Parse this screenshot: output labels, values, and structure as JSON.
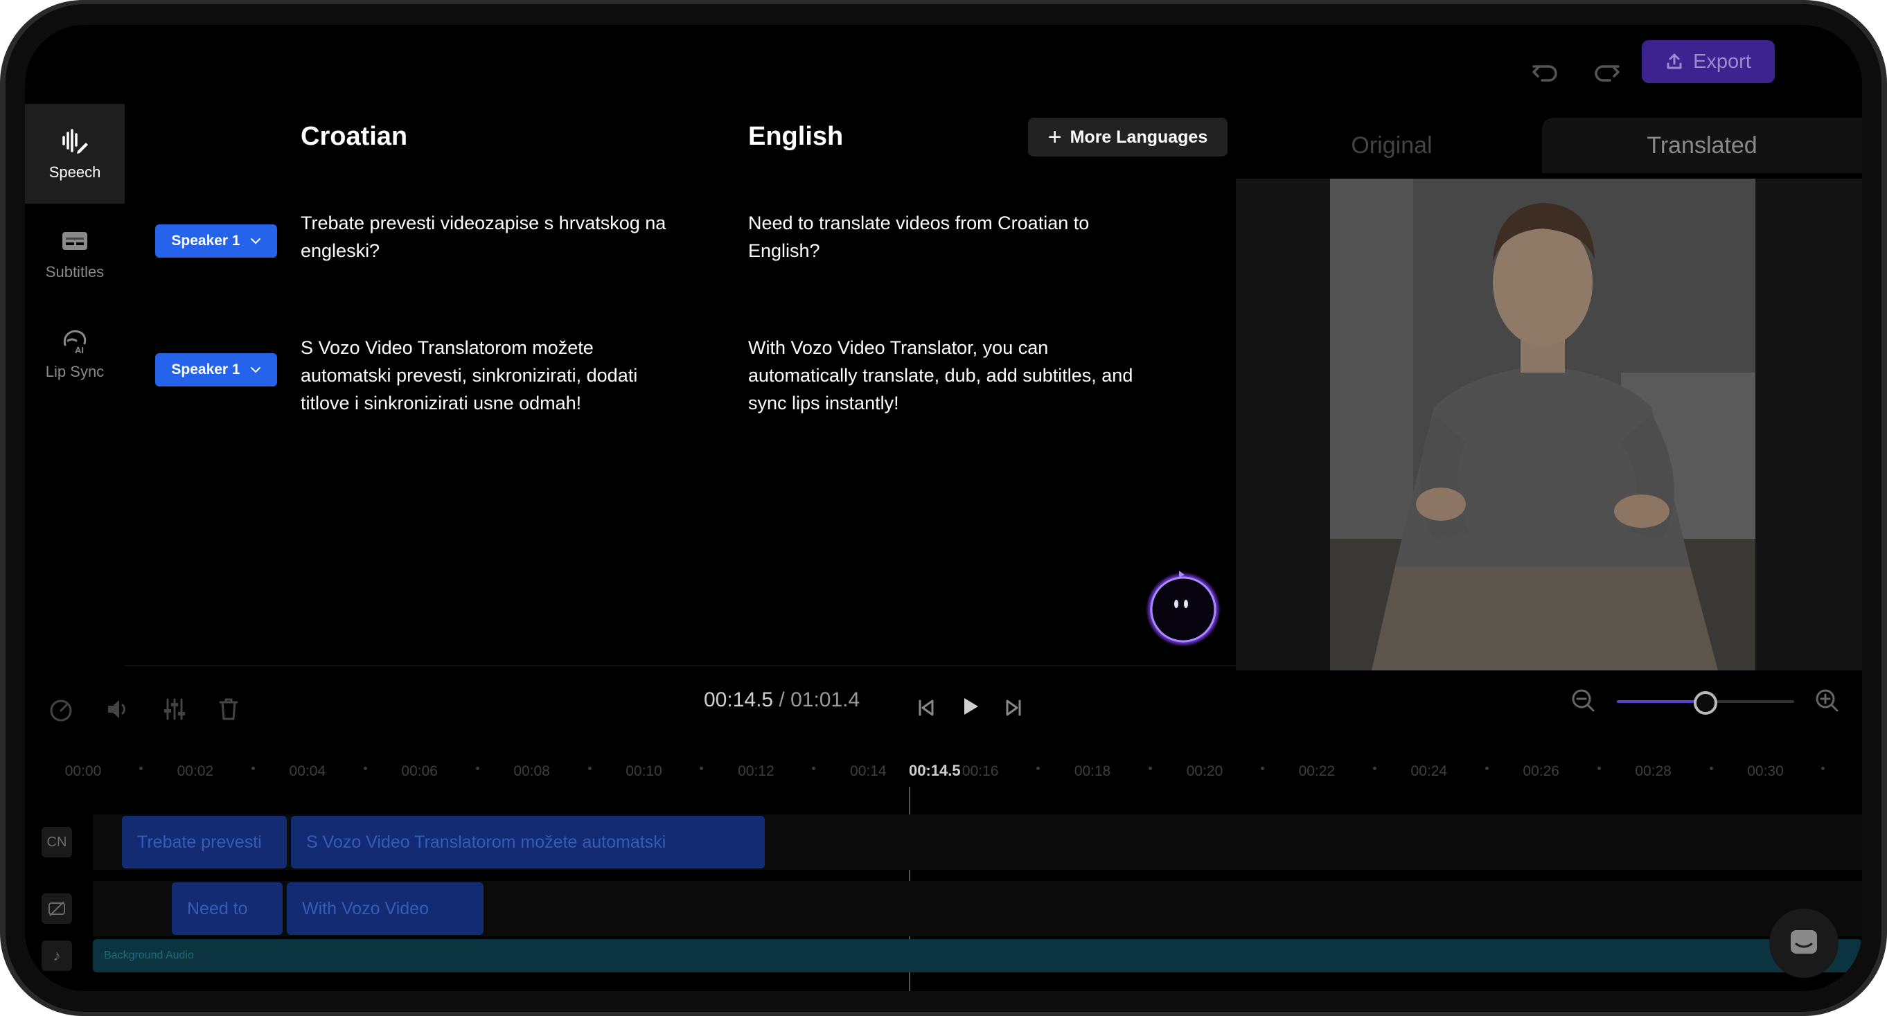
{
  "topbar": {
    "undo_icon": "undo-icon",
    "redo_icon": "redo-icon",
    "export_label": "Export"
  },
  "sidebar": {
    "items": [
      {
        "label": "Speech",
        "icon": "waveform-pen-icon"
      },
      {
        "label": "Subtitles",
        "icon": "subtitles-icon"
      },
      {
        "label": "Lip Sync",
        "icon": "ai-head-icon"
      }
    ]
  },
  "editor": {
    "source_language": "Croatian",
    "target_language": "English",
    "more_languages_label": "More Languages",
    "segments": [
      {
        "speaker": "Speaker 1",
        "source_text": "Trebate prevesti videozapise s hrvatskog na engleski?",
        "target_text": "Need to translate videos from Croatian to English?"
      },
      {
        "speaker": "Speaker 1",
        "source_text": "S Vozo Video Translatorom možete automatski prevesti, sinkronizirati, dodati titlove i sinkronizirati usne odmah!",
        "target_text": "With Vozo Video Translator, you can automatically translate, dub, add subtitles, and sync lips instantly!"
      }
    ]
  },
  "preview": {
    "tabs": [
      {
        "label": "Original",
        "active": false
      },
      {
        "label": "Translated",
        "active": true
      }
    ]
  },
  "controls": {
    "current_time": "00:14.5",
    "total_time": " / 01:01.4",
    "zoom_level": 0.5
  },
  "timeline": {
    "ticks": [
      "00:00",
      "00:02",
      "00:04",
      "00:06",
      "00:08",
      "00:10",
      "00:12",
      "00:14",
      "00:16",
      "00:18",
      "00:20",
      "00:22",
      "00:24",
      "00:26",
      "00:28",
      "00:30"
    ],
    "playhead_label": "00:14.5",
    "tracks": {
      "source_label": "CN",
      "source_clips": [
        "Trebate prevesti",
        "S Vozo Video Translatorom možete automatski"
      ],
      "target_clips": [
        "Need to",
        "With Vozo Video"
      ],
      "audio_label": "Background Audio"
    }
  },
  "colors": {
    "accent": "#2563eb",
    "export": "#3d238f",
    "zoom_fill": "#5b3fd1"
  }
}
